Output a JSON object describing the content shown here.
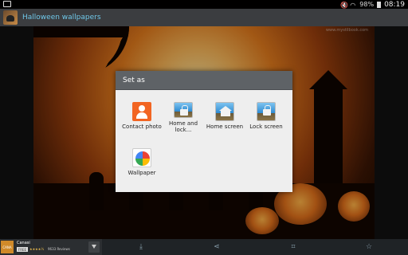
{
  "app": {
    "title": "Halloween wallpapers"
  },
  "status_bar": {
    "battery": "98%",
    "time": "08:19"
  },
  "wallpaper": {
    "watermark": "www.mystilbook.com"
  },
  "dialog": {
    "title": "Set as",
    "options": [
      {
        "label": "Contact photo",
        "icon": "contact-photo-icon"
      },
      {
        "label": "Home and lock...",
        "icon": "home-and-lock-icon"
      },
      {
        "label": "Home screen",
        "icon": "home-screen-icon"
      },
      {
        "label": "Lock screen",
        "icon": "lock-screen-icon"
      },
      {
        "label": "Wallpaper",
        "icon": "wallpaper-icon"
      }
    ]
  },
  "ad": {
    "title": "Canasi",
    "free": "FREE",
    "stars": "★★★★½",
    "reviews": "9633 Reviews"
  },
  "bottom_bar": {
    "icons": [
      "download-icon",
      "share-icon",
      "crop-icon",
      "favorite-icon"
    ]
  }
}
